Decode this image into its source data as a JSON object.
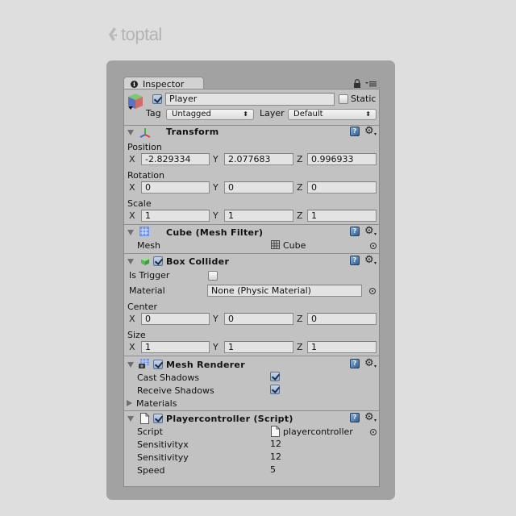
{
  "brand": {
    "name": "toptal"
  },
  "tab": {
    "label": "Inspector"
  },
  "header": {
    "active": true,
    "name": "Player",
    "static_label": "Static",
    "static": false,
    "tag_label": "Tag",
    "tag_value": "Untagged",
    "layer_label": "Layer",
    "layer_value": "Default"
  },
  "transform": {
    "title": "Transform",
    "position": {
      "label": "Position",
      "x": "-2.829334",
      "y": "2.077683",
      "z": "0.996933"
    },
    "rotation": {
      "label": "Rotation",
      "x": "0",
      "y": "0",
      "z": "0"
    },
    "scale": {
      "label": "Scale",
      "x": "1",
      "y": "1",
      "z": "1"
    },
    "axes": {
      "x": "X",
      "y": "Y",
      "z": "Z"
    }
  },
  "mesh_filter": {
    "title": "Cube (Mesh Filter)",
    "mesh_label": "Mesh",
    "mesh_value": "Cube"
  },
  "box_collider": {
    "title": "Box Collider",
    "enabled": true,
    "is_trigger_label": "Is Trigger",
    "is_trigger": false,
    "material_label": "Material",
    "material_value": "None (Physic Material)",
    "center": {
      "label": "Center",
      "x": "0",
      "y": "0",
      "z": "0"
    },
    "size": {
      "label": "Size",
      "x": "1",
      "y": "1",
      "z": "1"
    }
  },
  "mesh_renderer": {
    "title": "Mesh Renderer",
    "enabled": true,
    "cast_shadows_label": "Cast Shadows",
    "cast_shadows": true,
    "receive_shadows_label": "Receive Shadows",
    "receive_shadows": true,
    "materials_label": "Materials"
  },
  "script": {
    "title": "Playercontroller (Script)",
    "enabled": true,
    "script_label": "Script",
    "script_value": "playercontroller",
    "fields": [
      {
        "label": "Sensitivityx",
        "value": "12"
      },
      {
        "label": "Sensitivityy",
        "value": "12"
      },
      {
        "label": "Speed",
        "value": "5"
      }
    ]
  },
  "icons": {
    "help": "?",
    "gear": "⚙",
    "gear_caret": "▾",
    "dropdown_arrows": "⬍"
  }
}
